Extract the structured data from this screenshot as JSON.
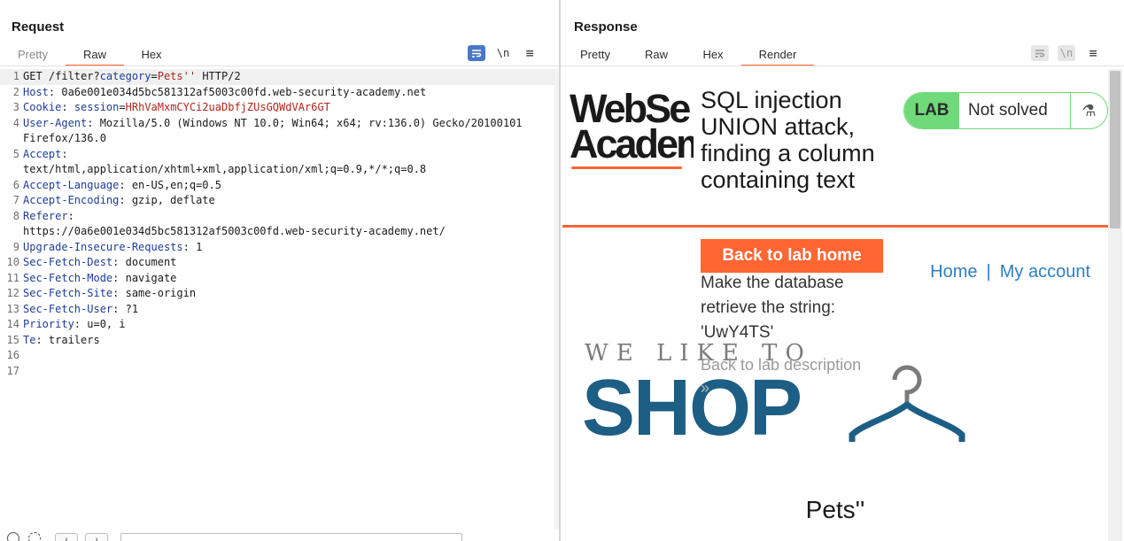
{
  "request": {
    "title": "Request",
    "tabs": [
      {
        "label": "Pretty",
        "state": "dim"
      },
      {
        "label": "Raw",
        "state": "active"
      },
      {
        "label": "Hex",
        "state": "normal"
      }
    ],
    "icons": [
      "wrap-lines-icon",
      "newline-icon",
      "menu-icon"
    ],
    "newline_glyph": "\\n",
    "menu_glyph": "≡",
    "lines": [
      {
        "n": "1",
        "key": "GET /filter?",
        "param": "category",
        "eq": "=",
        "val": "Pets''",
        "rest": " HTTP/2"
      },
      {
        "n": "2",
        "key": "Host",
        "sep": ": ",
        "val": "0a6e001e034d5bc581312af5003c00fd.web-security-academy.net"
      },
      {
        "n": "3",
        "key": "Cookie",
        "sep": ": ",
        "param": "session",
        "eq": "=",
        "val": "HRhVaMxmCYCi2uaDbfjZUsGQWdVAr6GT"
      },
      {
        "n": "4",
        "key": "User-Agent",
        "sep": ": ",
        "val": "Mozilla/5.0 (Windows NT 10.0; Win64; x64; rv:136.0) Gecko/20100101 Firefox/136.0"
      },
      {
        "n": "5",
        "key": "Accept",
        "sep": ":",
        "val": "text/html,application/xhtml+xml,application/xml;q=0.9,*/*;q=0.8"
      },
      {
        "n": "6",
        "key": "Accept-Language",
        "sep": ": ",
        "val": "en-US,en;q=0.5"
      },
      {
        "n": "7",
        "key": "Accept-Encoding",
        "sep": ": ",
        "val": "gzip, deflate"
      },
      {
        "n": "8",
        "key": "Referer",
        "sep": ":",
        "val": "https://0a6e001e034d5bc581312af5003c00fd.web-security-academy.net/"
      },
      {
        "n": "9",
        "key": "Upgrade-Insecure-Requests",
        "sep": ": ",
        "val": "1"
      },
      {
        "n": "10",
        "key": "Sec-Fetch-Dest",
        "sep": ": ",
        "val": "document"
      },
      {
        "n": "11",
        "key": "Sec-Fetch-Mode",
        "sep": ": ",
        "val": "navigate"
      },
      {
        "n": "12",
        "key": "Sec-Fetch-Site",
        "sep": ": ",
        "val": "same-origin"
      },
      {
        "n": "13",
        "key": "Sec-Fetch-User",
        "sep": ": ",
        "val": "?1"
      },
      {
        "n": "14",
        "key": "Priority",
        "sep": ": ",
        "val": "u=0, i"
      },
      {
        "n": "15",
        "key": "Te",
        "sep": ": ",
        "val": "trailers"
      },
      {
        "n": "16",
        "key": "",
        "sep": "",
        "val": ""
      },
      {
        "n": "17",
        "key": "",
        "sep": "",
        "val": ""
      }
    ]
  },
  "response": {
    "title": "Response",
    "tabs": [
      {
        "label": "Pretty",
        "state": "normal"
      },
      {
        "label": "Raw",
        "state": "normal"
      },
      {
        "label": "Hex",
        "state": "normal"
      },
      {
        "label": "Render",
        "state": "active"
      }
    ],
    "newline_glyph": "\\n",
    "menu_glyph": "≡",
    "render": {
      "logo_line1": "WebSe",
      "logo_line2": "Academ",
      "lab_title": "SQL injection UNION attack, finding a column containing text",
      "lab_badge": "LAB",
      "lab_status": "Not solved",
      "flask_glyph": "⚗",
      "back_button": "Back to lab home",
      "description": "Make the database retrieve the string: 'UwY4TS'",
      "back_description": "Back to lab description",
      "back_arrow": "»",
      "nav_home": "Home",
      "nav_sep": "|",
      "nav_account": "My account",
      "hero_small": "WE LIKE TO",
      "hero_big": "SHOP",
      "page_heading": "Pets''"
    }
  },
  "bottombar": {
    "back": "‹",
    "forward": "›"
  },
  "colors": {
    "accent": "#ff6633",
    "key_blue": "#1f3c99",
    "value_red": "#b0261a",
    "lab_green": "#70d97a",
    "link_blue": "#2f7fc1",
    "shop_blue": "#1d5e85",
    "toggle_blue": "#3c6fc1"
  }
}
